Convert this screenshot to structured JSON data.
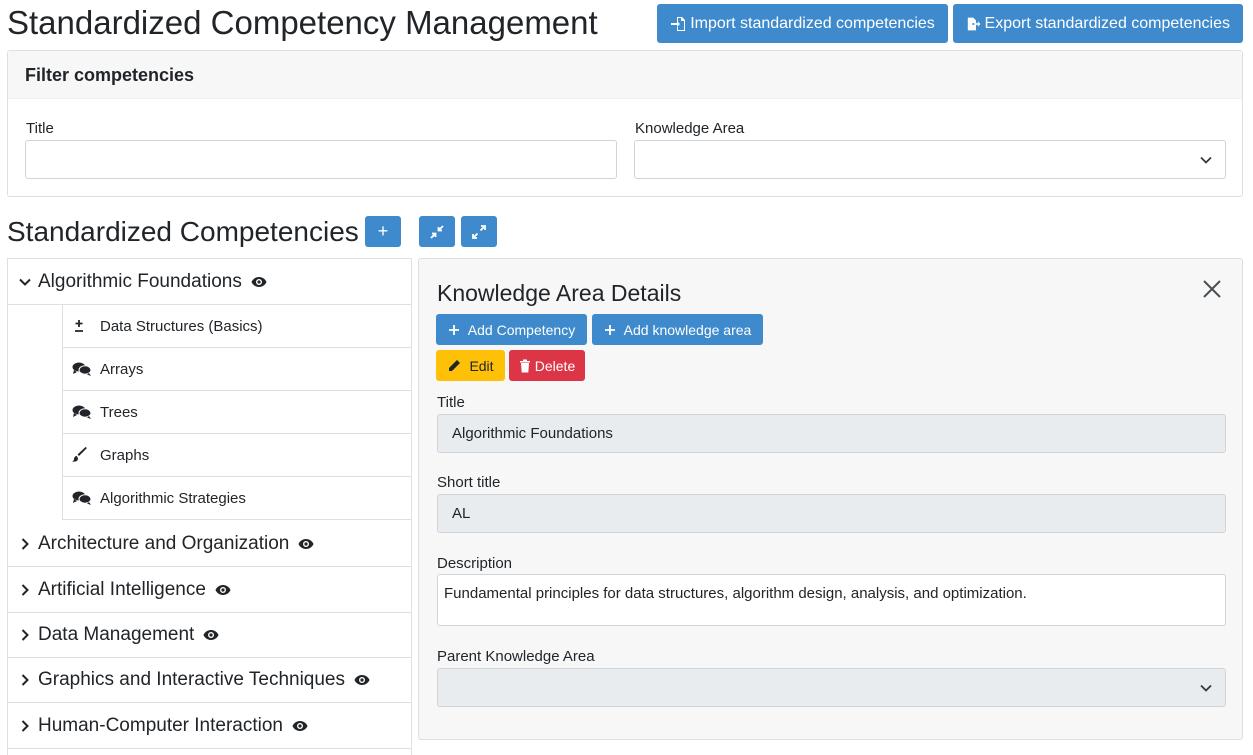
{
  "header": {
    "title": "Standardized Competency Management",
    "import_label": "Import standardized competencies",
    "export_label": "Export standardized competencies"
  },
  "filter": {
    "heading": "Filter competencies",
    "title_label": "Title",
    "title_value": "",
    "knowledge_area_label": "Knowledge Area",
    "knowledge_area_value": ""
  },
  "list": {
    "heading": "Standardized Competencies",
    "add_label": "+"
  },
  "tree": {
    "expanded": {
      "label": "Algorithmic Foundations",
      "children": [
        {
          "label": "Data Structures (Basics)",
          "icon": "plus-minus-icon"
        },
        {
          "label": "Arrays",
          "icon": "comments-icon"
        },
        {
          "label": "Trees",
          "icon": "comments-icon"
        },
        {
          "label": "Graphs",
          "icon": "brush-icon"
        },
        {
          "label": "Algorithmic Strategies",
          "icon": "comments-icon"
        }
      ]
    },
    "collapsed": [
      {
        "label": "Architecture and Organization"
      },
      {
        "label": "Artificial Intelligence"
      },
      {
        "label": "Data Management"
      },
      {
        "label": "Graphics and Interactive Techniques"
      },
      {
        "label": "Human-Computer Interaction"
      }
    ]
  },
  "details": {
    "heading": "Knowledge Area Details",
    "add_competency_label": "Add Competency",
    "add_knowledge_area_label": "Add knowledge area",
    "edit_label": "Edit",
    "delete_label": "Delete",
    "title_label": "Title",
    "title_value": "Algorithmic Foundations",
    "short_title_label": "Short title",
    "short_title_value": "AL",
    "description_label": "Description",
    "description_value": "Fundamental principles for data structures, algorithm design, analysis, and optimization.",
    "parent_label": "Parent Knowledge Area",
    "parent_value": ""
  },
  "colors": {
    "primary": "#3e8acc",
    "warning": "#ffc107",
    "danger": "#dc3545"
  }
}
